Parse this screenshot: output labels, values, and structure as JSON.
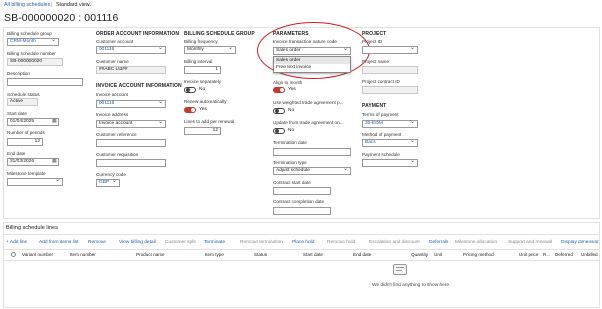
{
  "breadcrumb": {
    "link": "All billing schedules",
    "separator": "|",
    "view": "Standard view"
  },
  "page_title": "SB-000000020 : 001116",
  "col1": {
    "billing_schedule_group_label": "Billing schedule group",
    "billing_schedule_group_value": "CRM-Month",
    "billing_schedule_number_label": "Billing schedule number",
    "billing_schedule_number_value": "SB-000000020",
    "description_label": "Description",
    "description_value": "",
    "schedule_status_label": "Schedule status",
    "schedule_status_value": "Active",
    "start_date_label": "Start date",
    "start_date_value": "01/04/2025",
    "number_of_periods_label": "Number of periods",
    "number_of_periods_value": "12",
    "end_date_label": "End date",
    "end_date_value": "31/03/2026",
    "milestone_template_label": "Milestone template",
    "milestone_template_value": ""
  },
  "col2": {
    "header": "ORDER ACCOUNT INFORMATION",
    "customer_account_label": "Customer account",
    "customer_account_value": "001116",
    "customer_name_label": "Customer name",
    "customer_name_value": "##ABC Ltd##",
    "invoice_header": "INVOICE ACCOUNT INFORMATION",
    "invoice_account_label": "Invoice account",
    "invoice_account_value": "001116",
    "invoice_address_label": "Invoice address",
    "invoice_address_value": "Invoice account",
    "customer_reference_label": "Customer reference",
    "customer_requisition_label": "Customer requisition",
    "currency_code_label": "Currency code",
    "currency_code_value": "GBP"
  },
  "col3": {
    "header": "BILLING SCHEDULE GROUP",
    "billing_frequency_label": "Billing frequency",
    "billing_frequency_value": "Monthly",
    "billing_interval_label": "Billing interval",
    "billing_interval_value": "1",
    "invoice_separately_label": "Invoice separately",
    "invoice_separately_state": "No",
    "renew_automatically_label": "Renew automatically",
    "renew_automatically_state": "Yes",
    "lines_to_add_label": "Lines to add per renewal",
    "lines_to_add_value": "12"
  },
  "col4": {
    "header": "PARAMETERS",
    "invoice_transaction_label": "Invoice transaction nature code",
    "invoice_transaction_value": "Sales order",
    "dropdown_options": [
      "Sales order",
      "Free text invoice"
    ],
    "align_to_month_label": "Align to month",
    "align_to_month_state": "Yes",
    "use_weighted_label": "Use weighted trade agreement p...",
    "use_weighted_state": "No",
    "update_from_trade_label": "Update from trade agreement on...",
    "update_from_trade_state": "No",
    "termination_date_label": "Termination date",
    "termination_type_label": "Termination type",
    "termination_type_value": "Adjust schedule",
    "contract_start_label": "Contract start date",
    "contract_completion_label": "Contract completion date"
  },
  "col5": {
    "header": "PROJECT",
    "project_id_label": "Project ID",
    "project_name_label": "Project name",
    "project_contract_label": "Project contract ID",
    "payment_header": "PAYMENT",
    "terms_label": "Terms of payment",
    "terms_value": "30-EOM",
    "method_label": "Method of payment",
    "method_value": "Bacs",
    "payment_schedule_label": "Payment schedule"
  },
  "lines": {
    "title": "Billing schedule lines",
    "toolbar": [
      "+ Add line",
      "Add from items list",
      "Remove",
      "View billing detail",
      "Customer split",
      "Terminate",
      "Remove termination",
      "Place hold",
      "Remove hold",
      "Escalation and discount",
      "Deferrals",
      "Milestone allocation",
      "Support and renewal",
      "Display dimensions"
    ],
    "columns": [
      "Variant number",
      "Item number",
      "Product name",
      "Item type",
      "Status",
      "Start date",
      "End date",
      "Quantity",
      "Unit",
      "Pricing method",
      "Unit price",
      "R...",
      "Deferred",
      "Unbilled"
    ],
    "empty_message": "We didn't find anything to show here."
  },
  "colors": {
    "accent": "#1f5fa8",
    "toggle_on": "#c8372d",
    "annotation": "#d0201f"
  }
}
